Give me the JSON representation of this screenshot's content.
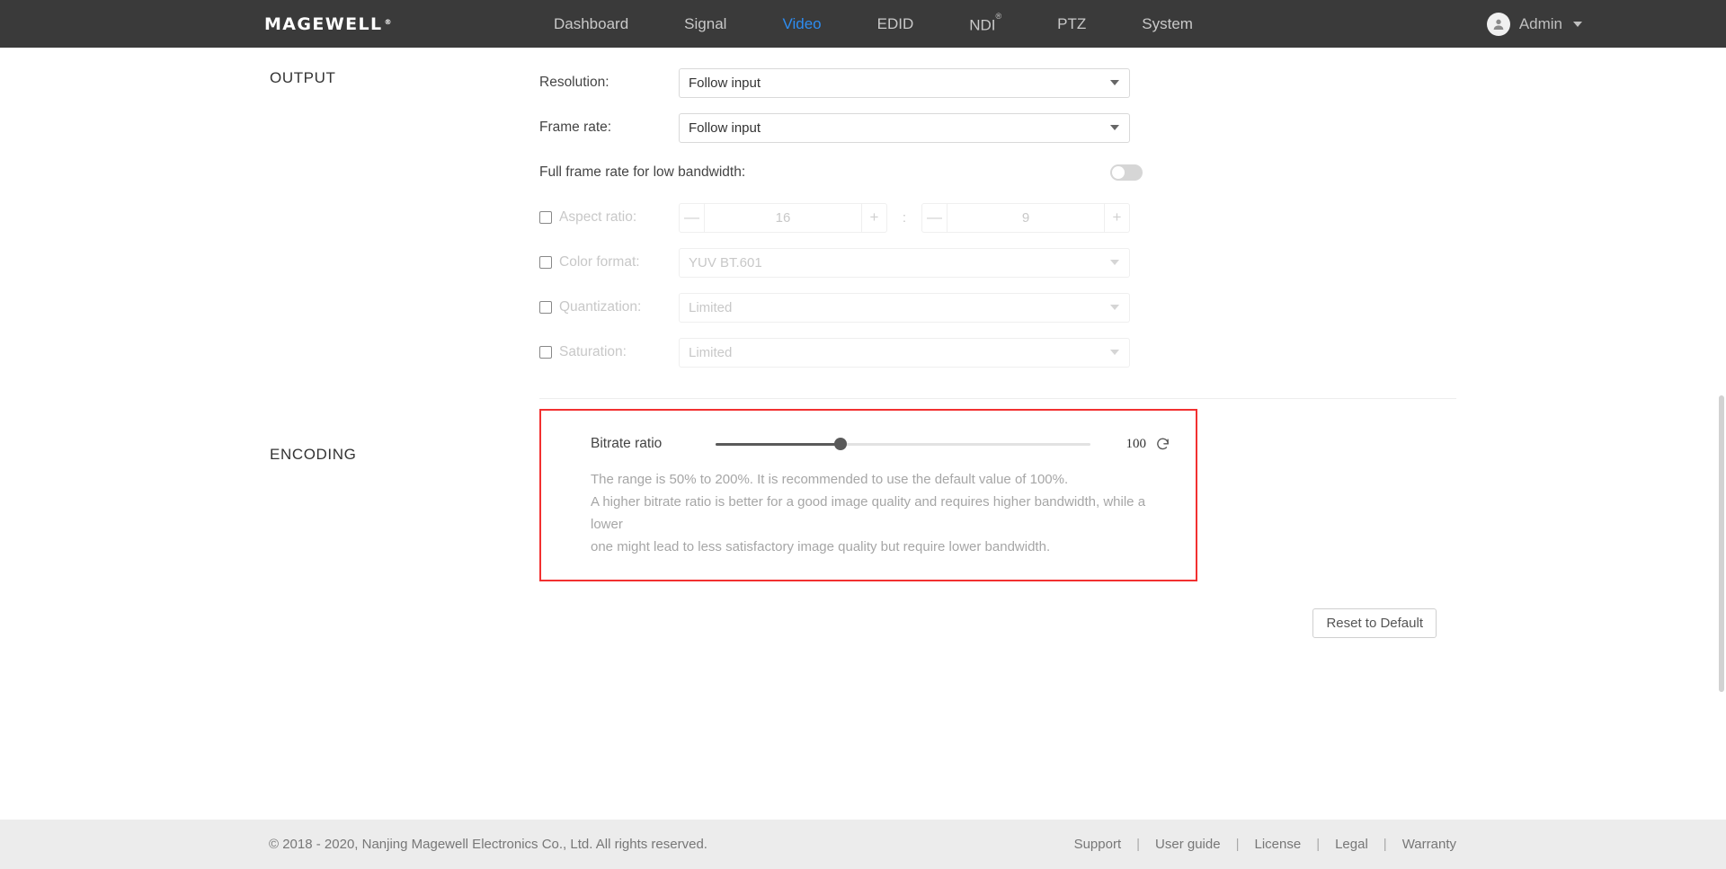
{
  "header": {
    "brand": "MAGEWELL",
    "brand_sup": "®",
    "nav": [
      {
        "label": "Dashboard",
        "active": false
      },
      {
        "label": "Signal",
        "active": false
      },
      {
        "label": "Video",
        "active": true
      },
      {
        "label": "EDID",
        "active": false
      },
      {
        "label": "NDI",
        "sup": "®",
        "active": false
      },
      {
        "label": "PTZ",
        "active": false
      },
      {
        "label": "System",
        "active": false
      }
    ],
    "user": "Admin",
    "accent_color": "#2d8cf0",
    "bar_color": "#3a3a3a"
  },
  "output": {
    "title": "OUTPUT",
    "resolution_label": "Resolution:",
    "resolution_value": "Follow input",
    "framerate_label": "Frame rate:",
    "framerate_value": "Follow input",
    "fullframerate_label": "Full frame rate for low bandwidth:",
    "fullframerate_on": false,
    "aspect_label": "Aspect ratio:",
    "aspect_w": "16",
    "aspect_h": "9",
    "aspect_colon": ":",
    "minus": "—",
    "plus": "+",
    "colorformat_label": "Color format:",
    "colorformat_value": "YUV BT.601",
    "quantization_label": "Quantization:",
    "quantization_value": "Limited",
    "saturation_label": "Saturation:",
    "saturation_value": "Limited"
  },
  "encoding": {
    "title": "ENCODING",
    "bitrate_label": "Bitrate ratio",
    "bitrate_value": "100",
    "bitrate_min": 50,
    "bitrate_max": 200,
    "bitrate_percent": 33.3,
    "highlight_color": "#f23030",
    "description_line1": "The range is 50% to 200%. It is recommended to use the default value of 100%.",
    "description_line2": "A higher bitrate ratio is better for a good image quality and requires higher bandwidth, while a lower",
    "description_line3": "one might lead to less satisfactory image quality but require lower bandwidth."
  },
  "actions": {
    "reset_to_default": "Reset to Default"
  },
  "footer": {
    "copyright": "© 2018 - 2020, Nanjing Magewell Electronics Co., Ltd. All rights reserved.",
    "separator": "|",
    "links": [
      "Support",
      "User guide",
      "License",
      "Legal",
      "Warranty"
    ]
  }
}
